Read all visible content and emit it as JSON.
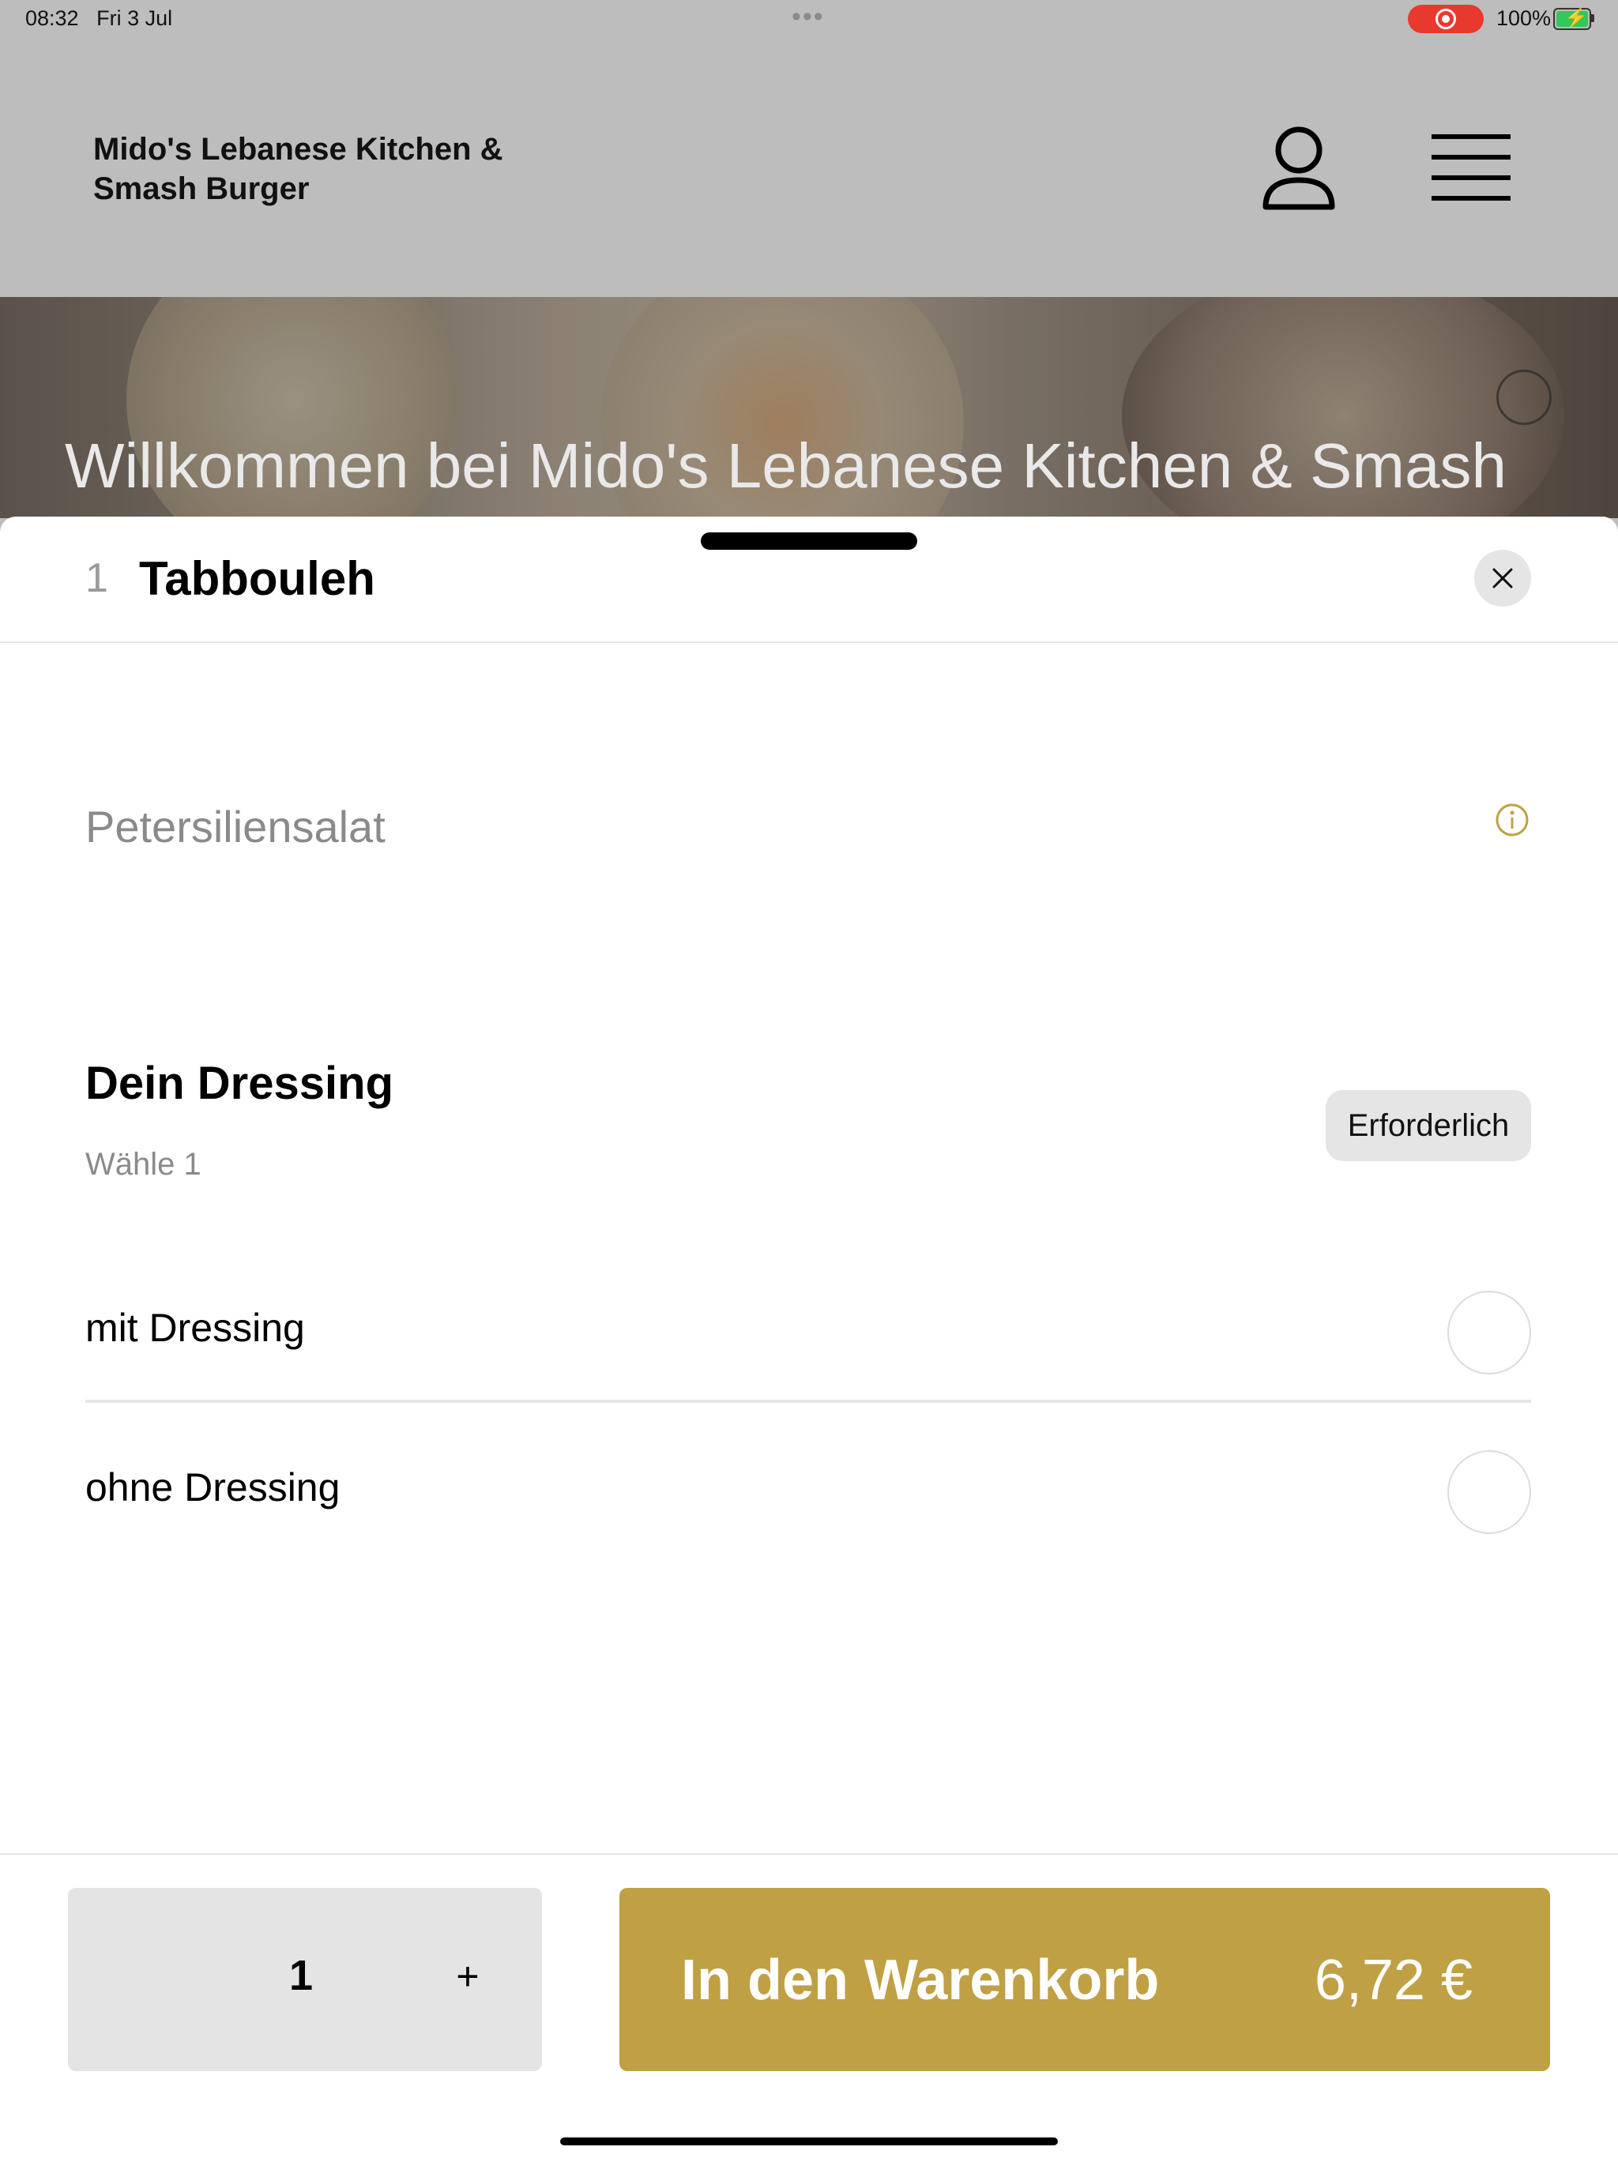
{
  "status_bar": {
    "time": "08:32",
    "date": "Fri 3 Jul",
    "battery": "100%",
    "record_color": "#e8392f"
  },
  "header": {
    "brand_line1": "Mido's Lebanese Kitchen &",
    "brand_line2": "Smash Burger",
    "icons": [
      "user-icon",
      "menu-icon"
    ]
  },
  "hero": {
    "title": "Willkommen bei Mido's Lebanese Kitchen & Smash"
  },
  "sheet": {
    "item_quantity": "1",
    "item_name": "Tabbouleh",
    "description": "Petersiliensalat",
    "section": {
      "title": "Dein Dressing",
      "subtitle": "Wähle 1",
      "badge": "Erforderlich",
      "options": [
        {
          "label": "mit Dressing",
          "selected": false
        },
        {
          "label": "ohne Dressing",
          "selected": false
        }
      ]
    }
  },
  "footer": {
    "quantity": "1",
    "plus": "+",
    "cart_label": "In den Warenkorb",
    "price": "6,72 €",
    "accent_color": "#bfa044"
  }
}
